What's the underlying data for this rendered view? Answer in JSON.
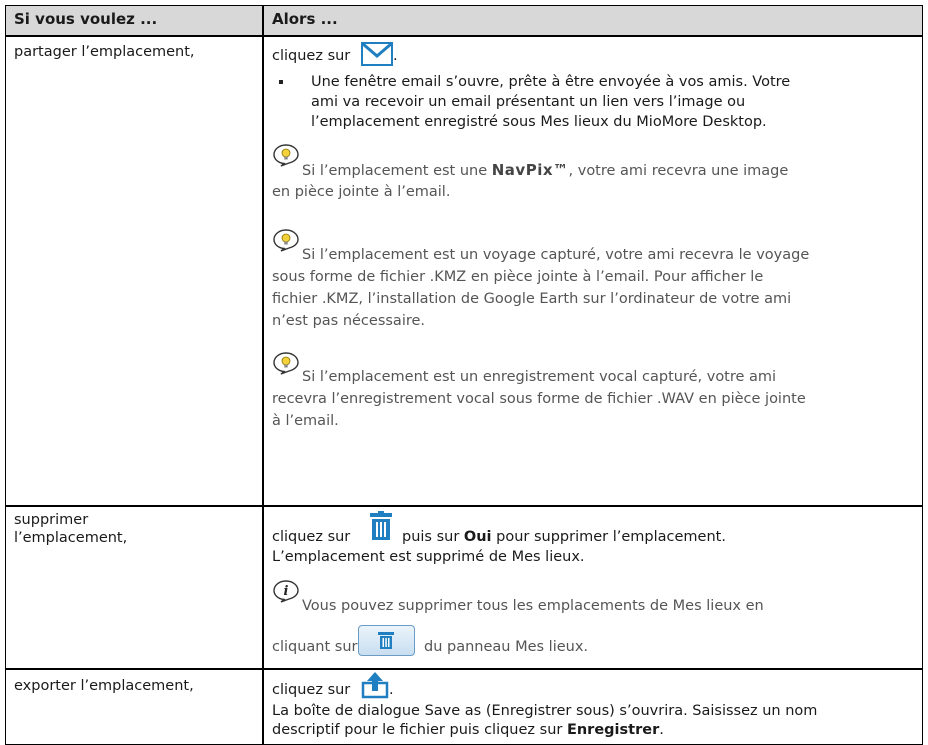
{
  "table": {
    "header": {
      "col1": "Si vous voulez ...",
      "col2": "Alors ..."
    },
    "rows": [
      {
        "action": "partager l’emplacement,",
        "click_prefix": "cliquez sur",
        "click_suffix": ".",
        "bullet_lines": [
          "Une fenêtre email s’ouvre, prête à être envoyée à vos amis. Votre",
          "ami va recevoir un email présentant un lien vers l’image ou",
          "l’emplacement enregistré sous Mes lieux du MioMore Desktop."
        ],
        "tip1_a": "Si l’emplacement est une ",
        "tip1_brand": "NavPix™",
        "tip1_b": ", votre ami recevra une image",
        "tip1_line2": "en pièce jointe à l’email.",
        "tip2_lines": [
          "Si l’emplacement est un voyage capturé, votre ami recevra le voyage",
          "sous forme de fichier .KMZ en pièce jointe à l’email. Pour afficher le",
          "fichier .KMZ, l’installation de Google Earth sur l’ordinateur de votre ami",
          "n’est pas nécessaire."
        ],
        "tip3_lines": [
          "Si l’emplacement est un enregistrement vocal capturé, votre ami",
          "recevra l’enregistrement vocal sous forme de fichier .WAV en pièce jointe",
          "à l’email."
        ],
        "icon": "envelope-icon"
      },
      {
        "action_line1": "supprimer",
        "action_line2": "l’emplacement,",
        "click_prefix": "cliquez sur",
        "click_mid": "puis sur",
        "click_bold": "Oui",
        "click_suffix": "pour supprimer l’emplacement.",
        "line2": "L’emplacement est supprimé de Mes lieux.",
        "info_line1": "Vous pouvez supprimer tous les emplacements de Mes lieux en",
        "info_line2_prefix": "cliquant sur",
        "info_line2_suffix": "du panneau Mes lieux.",
        "icon": "trash-icon"
      },
      {
        "action": "exporter l’emplacement,",
        "click_prefix": "cliquez sur",
        "click_suffix": ".",
        "line2": "La boîte de dialogue Save as (Enregistrer sous) s’ouvrira. Saisissez un nom",
        "line3_prefix": "descriptif pour le fichier puis cliquez sur ",
        "line3_bold": "Enregistrer",
        "line3_suffix": ".",
        "icon": "export-icon"
      }
    ]
  },
  "colors": {
    "header_bg": "#d8d8d8",
    "tip_text": "#555555",
    "icon_blue": "#1f7fc0"
  }
}
